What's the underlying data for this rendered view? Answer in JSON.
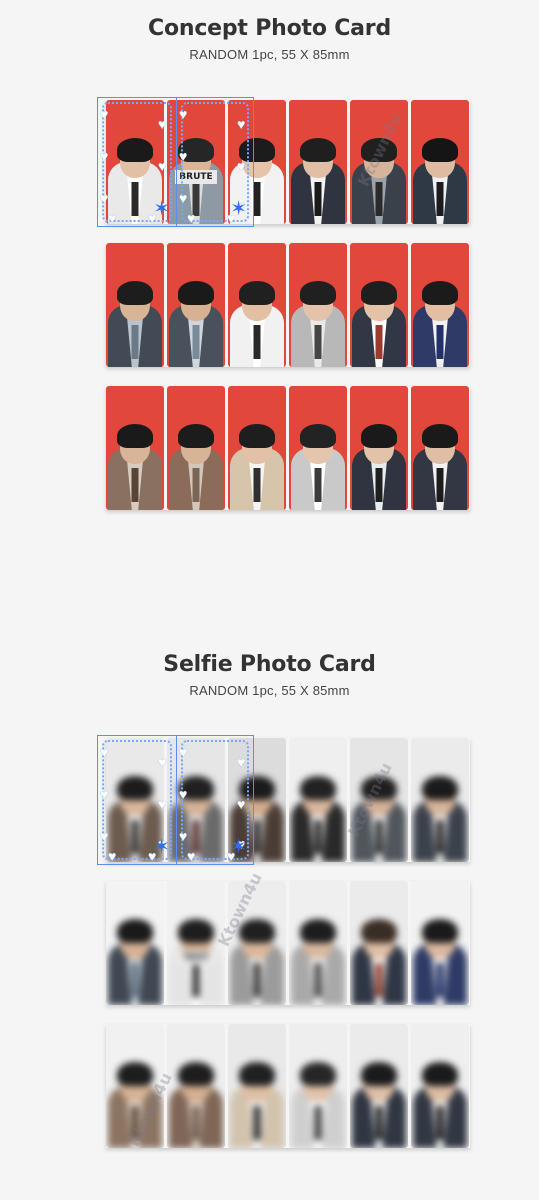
{
  "sections": [
    {
      "title": "Concept Photo Card",
      "subtitle": "RANDOM 1pc, 55 X 85mm",
      "rows": [
        [
          {
            "bg": "#e2473c",
            "hair": "#1a1a1a",
            "skin": "#e2c0a6",
            "jacket": "#e9e9e9",
            "shirt": "#ffffff",
            "tie": "#2a2a2a"
          },
          {
            "bg": "#e2473c",
            "hair": "#262626",
            "skin": "#dcb596",
            "jacket": "#8e9aa3",
            "shirt": "#dcdcdc",
            "tie": "#3a3a3a",
            "tag": "BRUTE"
          },
          {
            "bg": "#e2473c",
            "hair": "#1c1c1c",
            "skin": "#e6c4aa",
            "jacket": "#f2f2f2",
            "shirt": "#ffffff",
            "tie": "#222222"
          },
          {
            "bg": "#e2473c",
            "hair": "#1f1f1f",
            "skin": "#e2bea4",
            "jacket": "#2f3440",
            "shirt": "#f3f3f3",
            "tie": "#1a1a1a"
          },
          {
            "bg": "#e2473c",
            "hair": "#202020",
            "skin": "#d7b399",
            "jacket": "#3b414a",
            "shirt": "#9aa3aa",
            "tie": "#2a2a2a"
          },
          {
            "bg": "#e2473c",
            "hair": "#151515",
            "skin": "#dfbba1",
            "jacket": "#2f3945",
            "shirt": "#eef1f3",
            "tie": "#1b1b1b"
          }
        ],
        [
          {
            "bg": "#e2473c",
            "hair": "#1d1d1d",
            "skin": "#d9b598",
            "jacket": "#414a55",
            "shirt": "#b9c3cc",
            "tie": "#6b7a88"
          },
          {
            "bg": "#e2473c",
            "hair": "#1a1a1a",
            "skin": "#d7b191",
            "jacket": "#49525c",
            "shirt": "#cfd6dc",
            "tie": "#7a8b97"
          },
          {
            "bg": "#e2473c",
            "hair": "#202020",
            "skin": "#e3c0a4",
            "jacket": "#f1f1f1",
            "shirt": "#ffffff",
            "tie": "#2a2a2a"
          },
          {
            "bg": "#e2473c",
            "hair": "#202020",
            "skin": "#e4c3aa",
            "jacket": "#b8b8b8",
            "shirt": "#e9e9e9",
            "tie": "#454545"
          },
          {
            "bg": "#e2473c",
            "hair": "#1f1f1f",
            "skin": "#e3c2a8",
            "jacket": "#313744",
            "shirt": "#ffffff",
            "tie": "#9b3a2e"
          },
          {
            "bg": "#e2473c",
            "hair": "#1b1b1b",
            "skin": "#e1bea4",
            "jacket": "#2f3a66",
            "shirt": "#f1f1f1",
            "tie": "#24306a"
          }
        ],
        [
          {
            "bg": "#e2473c",
            "hair": "#1a1a1a",
            "skin": "#d9b497",
            "jacket": "#8a7060",
            "shirt": "#d8cbbf",
            "tie": "#5a4436"
          },
          {
            "bg": "#e2473c",
            "hair": "#1c1c1c",
            "skin": "#d8b395",
            "jacket": "#8b6b5a",
            "shirt": "#d2c7bb",
            "tie": "#7a6657"
          },
          {
            "bg": "#e2473c",
            "hair": "#1e1e1e",
            "skin": "#e3c1a6",
            "jacket": "#d6c4ab",
            "shirt": "#f4f4f4",
            "tie": "#303030"
          },
          {
            "bg": "#e2473c",
            "hair": "#232323",
            "skin": "#e5c6ad",
            "jacket": "#c9c9c9",
            "shirt": "#ffffff",
            "tie": "#3b3b3b"
          },
          {
            "bg": "#e2473c",
            "hair": "#1a1a1a",
            "skin": "#e2c2a9",
            "jacket": "#2f3440",
            "shirt": "#e7ecef",
            "tie": "#1f1f1f"
          },
          {
            "bg": "#e2473c",
            "hair": "#1a1a1a",
            "skin": "#e0bea6",
            "jacket": "#323743",
            "shirt": "#f2f2f2",
            "tie": "#1d1d1d"
          }
        ]
      ]
    },
    {
      "title": "Selfie Photo Card",
      "subtitle": "RANDOM 1pc, 55 X 85mm",
      "rows": [
        [
          {
            "bg": "#e9e9e9",
            "hair": "#1c1c1c",
            "skin": "#d9b69c",
            "jacket": "#6c5b4f",
            "shirt": "#f2f2f2",
            "tie": "#333333"
          },
          {
            "bg": "#e6e6e6",
            "hair": "#202020",
            "skin": "#d4b298",
            "jacket": "#6a6a6a",
            "shirt": "#ececec",
            "tie": "#5a2d2d"
          },
          {
            "bg": "#dcdcdc",
            "hair": "#1b1b1b",
            "skin": "#d2ad90",
            "jacket": "#4b3d35",
            "shirt": "#e5e5e5",
            "tie": "#2b2b2b"
          },
          {
            "bg": "#efefef",
            "hair": "#222222",
            "skin": "#d8b79e",
            "jacket": "#2a2a2a",
            "shirt": "#f6f6f6",
            "tie": "#222222"
          },
          {
            "bg": "#e5e5e5",
            "hair": "#1f1f1f",
            "skin": "#d5b299",
            "jacket": "#50565c",
            "shirt": "#f3f3f3",
            "tie": "#2b2b2b"
          },
          {
            "bg": "#ebebeb",
            "hair": "#1b1b1b",
            "skin": "#d8b59b",
            "jacket": "#3c424c",
            "shirt": "#f0f0f0",
            "tie": "#242424"
          }
        ],
        [
          {
            "bg": "#f3f3f3",
            "hair": "#1a1a1a",
            "skin": "#d7b295",
            "jacket": "#3f4853",
            "shirt": "#c9d1d8",
            "tie": "#607181"
          },
          {
            "bg": "#f1f1f1",
            "hair": "#1e1e1e",
            "skin": "#d2ad90",
            "jacket": "#e4e4e4",
            "shirt": "#ffffff",
            "tie": "#333333",
            "tag": "TEXT"
          },
          {
            "bg": "#ededed",
            "hair": "#202020",
            "skin": "#dbb79c",
            "jacket": "#9b9b9b",
            "shirt": "#ececec",
            "tie": "#3a3a3a"
          },
          {
            "bg": "#efefef",
            "hair": "#1d1d1d",
            "skin": "#d9b89f",
            "jacket": "#a9a9a9",
            "shirt": "#f3f3f3",
            "tie": "#464646"
          },
          {
            "bg": "#ebebeb",
            "hair": "#3a2d24",
            "skin": "#e0bfa5",
            "jacket": "#2f3645",
            "shirt": "#ffffff",
            "tie": "#8f3a2a"
          },
          {
            "bg": "#f2f2f2",
            "hair": "#1a1a1a",
            "skin": "#dcb9a0",
            "jacket": "#2e3b66",
            "shirt": "#f3f3f3",
            "tie": "#223066"
          }
        ],
        [
          {
            "bg": "#f1f1f1",
            "hair": "#1d1d1d",
            "skin": "#d7b395",
            "jacket": "#8c7462",
            "shirt": "#e2d7cc",
            "tie": "#5a4637"
          },
          {
            "bg": "#eeeeee",
            "hair": "#1e1e1e",
            "skin": "#d4ae90",
            "jacket": "#7f6656",
            "shirt": "#ddd1c6",
            "tie": "#705c4e"
          },
          {
            "bg": "#e9e9e9",
            "hair": "#202020",
            "skin": "#dfbea2",
            "jacket": "#d2c3ad",
            "shirt": "#f2f2f2",
            "tie": "#2e2e2e"
          },
          {
            "bg": "#eeeeee",
            "hair": "#262626",
            "skin": "#e1c2aa",
            "jacket": "#cfcfcf",
            "shirt": "#ffffff",
            "tie": "#3b3b3b"
          },
          {
            "bg": "#ebebeb",
            "hair": "#1b1b1b",
            "skin": "#dfc0a8",
            "jacket": "#303642",
            "shirt": "#eff2f4",
            "tie": "#1f1f1f"
          },
          {
            "bg": "#efefef",
            "hair": "#1a1a1a",
            "skin": "#ddbca4",
            "jacket": "#313743",
            "shirt": "#f3f3f3",
            "tie": "#1c1c1c"
          }
        ]
      ]
    }
  ],
  "watermark_text": "Ktown4u"
}
